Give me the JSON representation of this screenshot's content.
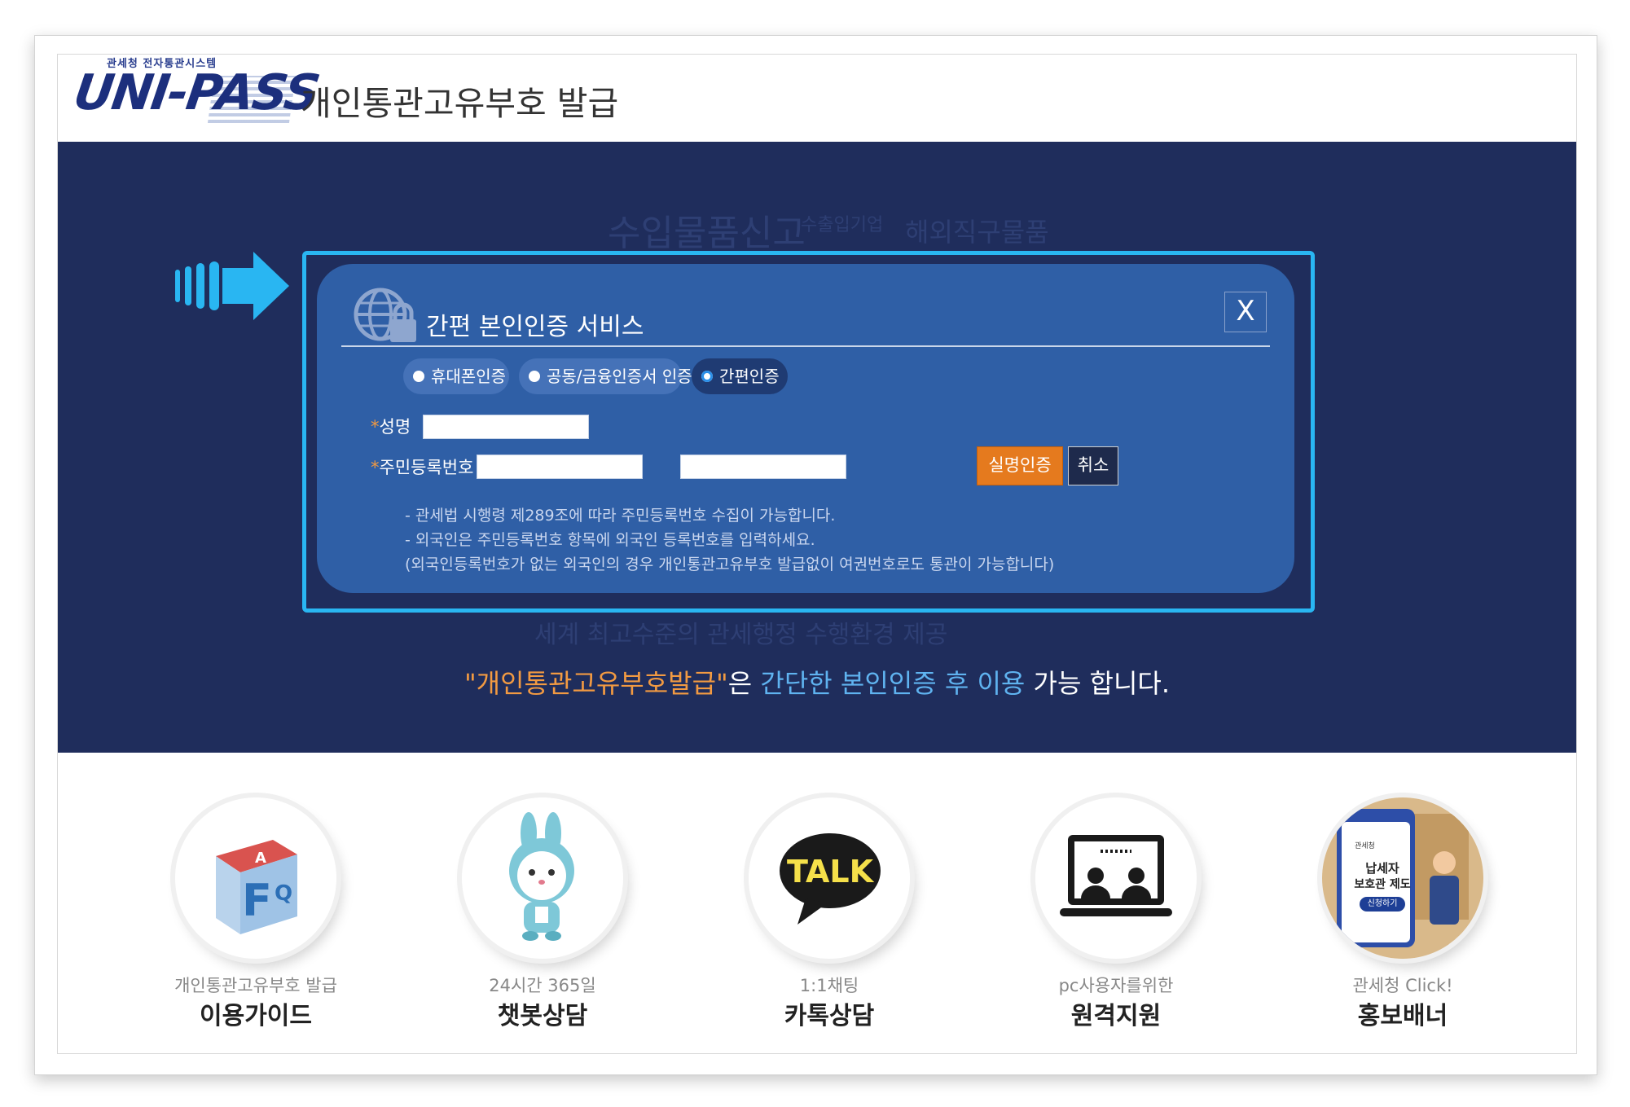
{
  "header": {
    "logo_sub": "관세청 전자통관시스템",
    "logo_text": "UNI-PASS",
    "title": "개인통관고유부호 발급"
  },
  "background_ghost": {
    "line1": "수입물품신고",
    "line1_small": "수출입기업",
    "line1_right": "해외직구물품",
    "line2": "세계 최고수준의 관세행정 수행환경 제공"
  },
  "modal": {
    "title": "간편 본인인증 서비스",
    "close_label": "X",
    "tabs": [
      {
        "label": "휴대폰인증",
        "selected": false
      },
      {
        "label": "공동/금융인증서 인증",
        "selected": false
      },
      {
        "label": "간편인증",
        "selected": true
      }
    ],
    "name_label": "성명",
    "rrn_label": "주민등록번호",
    "required_mark": "*",
    "name_value": "",
    "rrn_front_value": "",
    "rrn_back_value": "",
    "dash": "-",
    "verify_button": "실명인증",
    "cancel_button": "취소",
    "info": [
      "- 관세법 시행령 제289조에 따라 주민등록번호 수집이 가능합니다.",
      "- 외국인은 주민등록번호 항목에 외국인 등록번호를 입력하세요.",
      "(외국인등록번호가 없는 외국인의 경우 개인통관고유부호 발급없이 여권번호로도 통관이 가능합니다)"
    ]
  },
  "notice": {
    "part1": "\"개인통관고유부호발급\"",
    "part2": "은 ",
    "part3": "간단한 본인인증 후 이용",
    "part4": " 가능 합니다."
  },
  "quick_menu": [
    {
      "sub": "개인통관고유부호 발급",
      "main": "이용가이드",
      "icon": "faq-cube-icon"
    },
    {
      "sub": "24시간 365일",
      "main": "챗봇상담",
      "icon": "chatbot-rabbit-icon"
    },
    {
      "sub": "1:1채팅",
      "main": "카톡상담",
      "icon": "kakaotalk-icon"
    },
    {
      "sub": "pc사용자를위한",
      "main": "원격지원",
      "icon": "remote-support-icon"
    },
    {
      "sub": "관세청 Click!",
      "main": "홍보배너",
      "icon": "promo-banner-icon"
    }
  ],
  "promo_banner": {
    "agency": "관세청",
    "line1": "납세자",
    "line2": "보호관 제도",
    "button": "신청하기"
  },
  "colors": {
    "navy_band": "#1f2d5c",
    "modal_bg": "#2f5fa6",
    "highlight_outline": "#29b6f2",
    "verify_button": "#e57a1e",
    "notice_orange": "#f29a42",
    "notice_blue": "#5fb3f0"
  }
}
